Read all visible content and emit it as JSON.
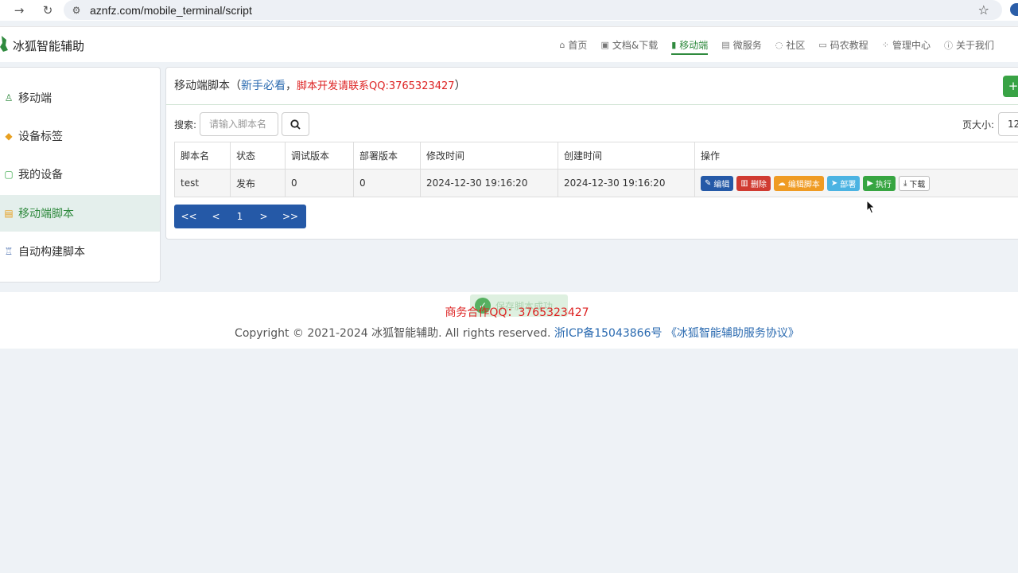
{
  "browser": {
    "url": "aznfz.com/mobile_terminal/script"
  },
  "header": {
    "brand": "冰狐智能辅助",
    "nav": [
      {
        "label": "首页",
        "icon": "home-icon"
      },
      {
        "label": "文档&下载",
        "icon": "document-icon"
      },
      {
        "label": "移动端",
        "icon": "mobile-icon",
        "active": true
      },
      {
        "label": "微服务",
        "icon": "grid-icon"
      },
      {
        "label": "社区",
        "icon": "chat-icon"
      },
      {
        "label": "码农教程",
        "icon": "book-icon"
      },
      {
        "label": "管理中心",
        "icon": "dashboard-icon"
      },
      {
        "label": "关于我们",
        "icon": "info-icon"
      }
    ]
  },
  "sidebar": {
    "items": [
      {
        "label": "移动端",
        "icon": "user-phone-icon"
      },
      {
        "label": "设备标签",
        "icon": "tag-icon"
      },
      {
        "label": "我的设备",
        "icon": "device-icon"
      },
      {
        "label": "移动端脚本",
        "icon": "script-icon",
        "active": true
      },
      {
        "label": "自动构建脚本",
        "icon": "robot-icon"
      }
    ]
  },
  "panel": {
    "title": "移动端脚本（",
    "title_link": "新手必看",
    "title_sep": "，",
    "title_contact": "脚本开发请联系QQ:3765323427",
    "title_end": "）",
    "add_label": "+",
    "search_label": "搜索:",
    "search_placeholder": "请输入脚本名",
    "page_size_label": "页大小:",
    "page_size_value": "12"
  },
  "table": {
    "columns": [
      "脚本名",
      "状态",
      "调试版本",
      "部署版本",
      "修改时间",
      "创建时间",
      "操作"
    ],
    "rows": [
      {
        "name": "test",
        "status": "发布",
        "debug_version": "0",
        "deploy_version": "0",
        "modified": "2024-12-30 19:16:20",
        "created": "2024-12-30 19:16:20"
      }
    ],
    "actions": {
      "edit": "编辑",
      "delete": "删除",
      "edit_script": "编辑脚本",
      "deploy": "部署",
      "run": "执行",
      "download": "下载"
    }
  },
  "pagination": {
    "first": "<<",
    "prev": "<",
    "current": "1",
    "next": ">",
    "last": ">>"
  },
  "footer": {
    "business": "商务合作QQ：3765323427",
    "copyright": "Copyright © 2021-2024 冰狐智能辅助. All rights reserved. ",
    "icp": "浙ICP备15043866号",
    "agreement": "《冰狐智能辅助服务协议》",
    "toast": "保存脚本成功"
  }
}
